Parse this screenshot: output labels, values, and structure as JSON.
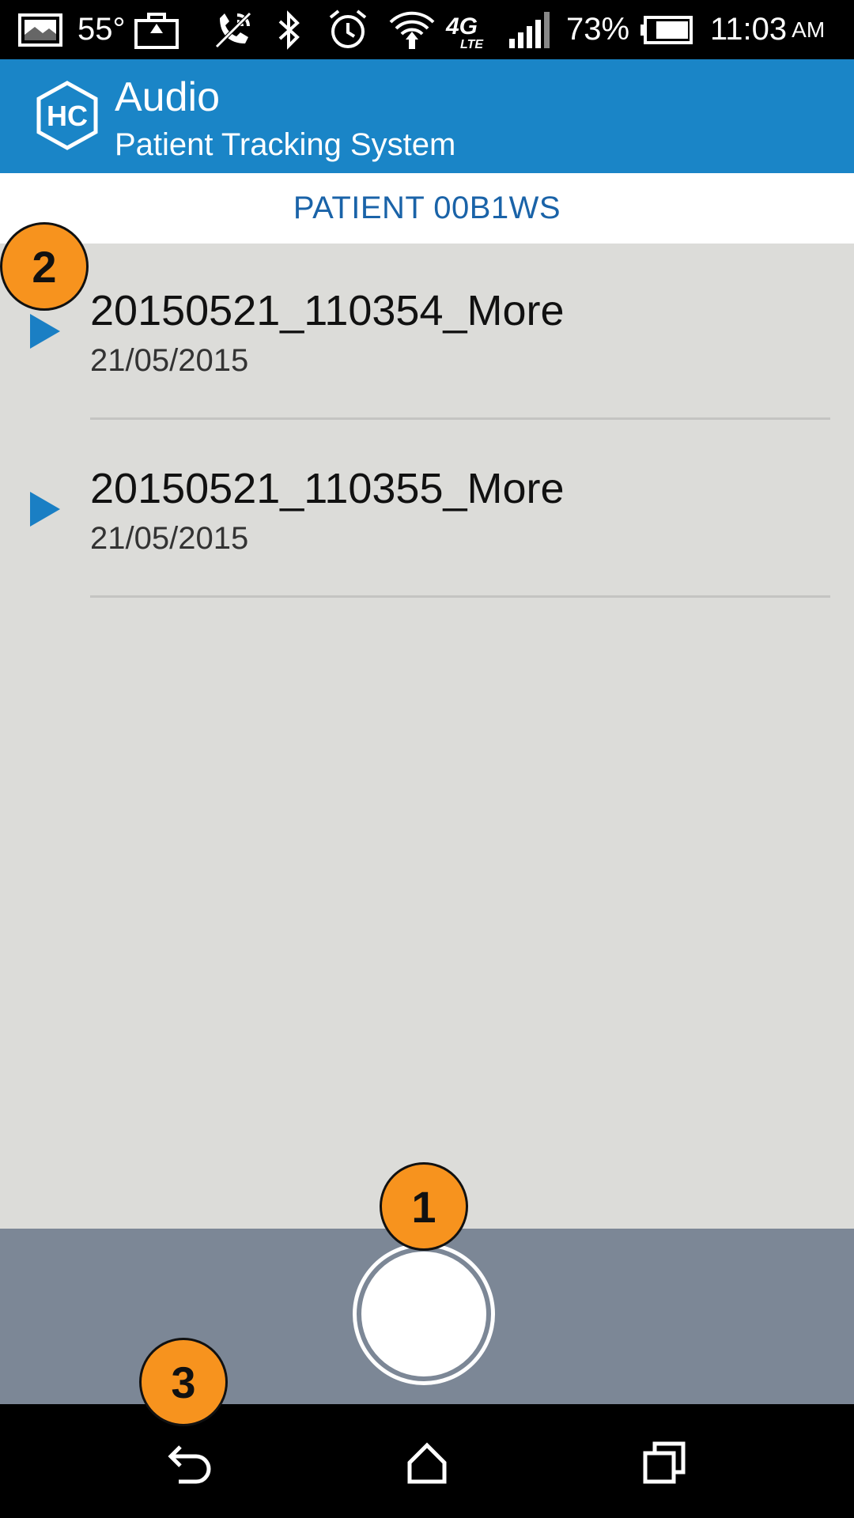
{
  "status_bar": {
    "temperature": "55°",
    "battery_percent": "73%",
    "time": "11:03",
    "ampm": "AM",
    "network_type": "4G LTE",
    "icons": [
      "gallery-icon",
      "briefcase-icon",
      "mute-call-icon",
      "bluetooth-icon",
      "alarm-icon",
      "wifi-icon",
      "lte-icon",
      "signal-icon",
      "battery-icon"
    ]
  },
  "app_bar": {
    "logo_text": "HC",
    "title": "Audio",
    "subtitle": "Patient Tracking System",
    "background_color": "#1a85c7"
  },
  "patient": {
    "label": "PATIENT 00B1WS"
  },
  "recordings": [
    {
      "name": "20150521_110354_More",
      "date": "21/05/2015"
    },
    {
      "name": "20150521_110355_More",
      "date": "21/05/2015"
    }
  ],
  "record_button": {
    "icon": "record-icon"
  },
  "nav_bar": {
    "icons": [
      "back-icon",
      "home-icon",
      "recents-icon"
    ]
  },
  "callouts": [
    "1",
    "2",
    "3"
  ]
}
